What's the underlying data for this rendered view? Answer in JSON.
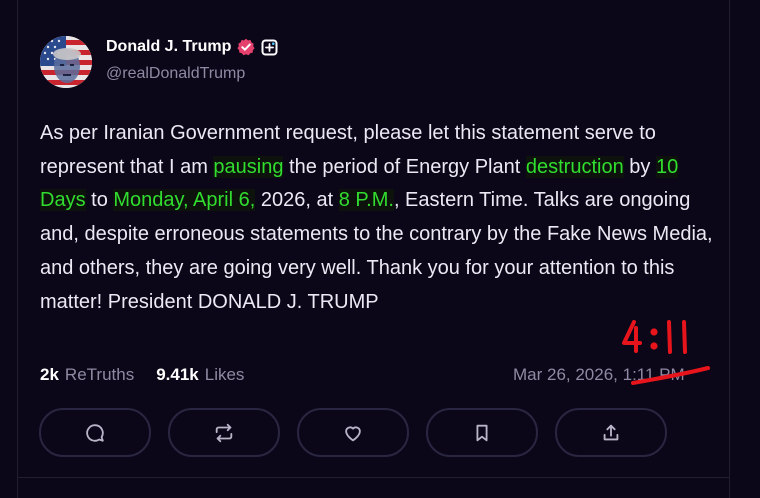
{
  "post": {
    "author": {
      "display_name": "Donald J. Trump",
      "handle": "@realDonaldTrump",
      "verified_icon": "verified-badge-icon",
      "plus_icon": "plus-badge-icon"
    },
    "body": [
      {
        "text": "As per Iranian Government request, please let this statement serve to represent that I am ",
        "highlight": false
      },
      {
        "text": "pausing",
        "highlight": true
      },
      {
        "text": " the period of Energy Plant ",
        "highlight": false
      },
      {
        "text": "destruction",
        "highlight": true
      },
      {
        "text": " by ",
        "highlight": false
      },
      {
        "text": "10 Days",
        "highlight": true
      },
      {
        "text": " to ",
        "highlight": false
      },
      {
        "text": "Monday, April 6,",
        "highlight": true
      },
      {
        "text": " 2026, at ",
        "highlight": false
      },
      {
        "text": "8 P.M.",
        "highlight": true
      },
      {
        "text": ", Eastern Time. Talks are ongoing and, despite erroneous statements to the contrary by the Fake News Media, and others, they are going very well. Thank you for your attention to this matter! President DONALD J. TRUMP",
        "highlight": false
      }
    ],
    "stats": {
      "retruths_count": "2k",
      "retruths_label": "ReTruths",
      "likes_count": "9.41k",
      "likes_label": "Likes"
    },
    "timestamp": "Mar 26, 2026, 1:11 PM",
    "annotation": {
      "handwritten_text": "4:11",
      "color": "#e8141b"
    }
  },
  "actions": [
    {
      "name": "reply",
      "icon": "reply-icon"
    },
    {
      "name": "retruth",
      "icon": "retruth-icon"
    },
    {
      "name": "like",
      "icon": "heart-icon"
    },
    {
      "name": "bookmark",
      "icon": "bookmark-icon"
    },
    {
      "name": "share",
      "icon": "share-icon"
    }
  ],
  "colors": {
    "background": "#0b0718",
    "text": "#ece9f4",
    "muted": "#8f8aa3",
    "highlight_green": "#31dd2f",
    "verified_pink": "#e5416e",
    "button_border": "#2a2540"
  }
}
